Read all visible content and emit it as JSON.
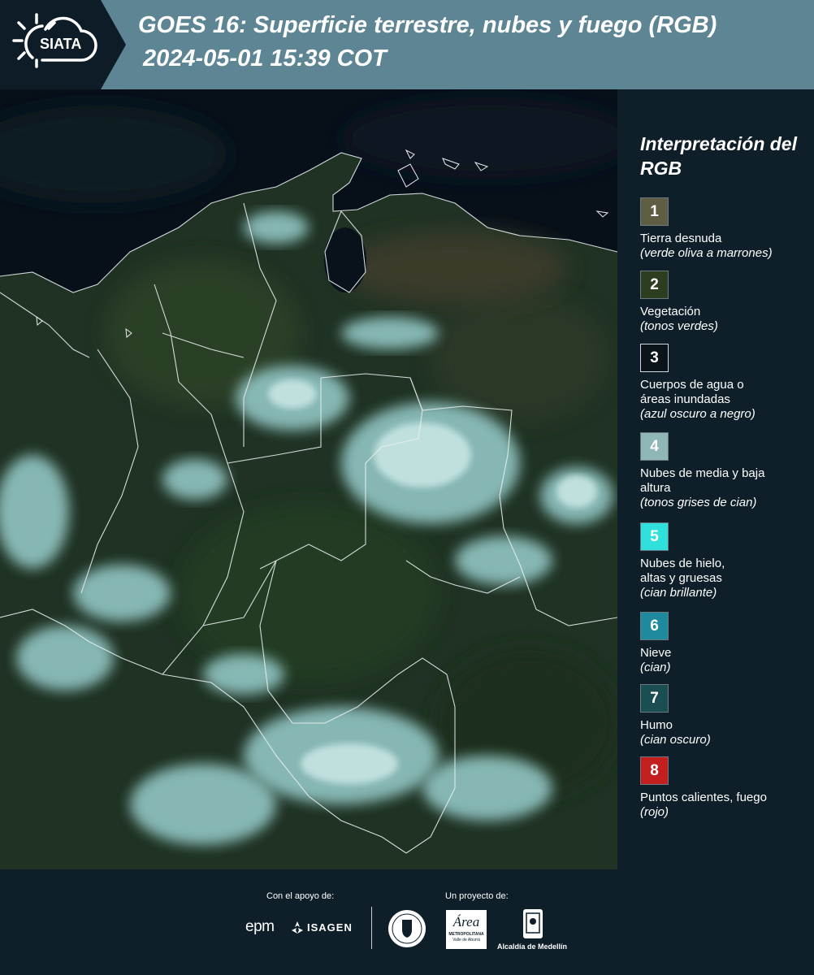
{
  "header": {
    "logo_text": "SIATA",
    "title_line1": "GOES 16: Superficie terrestre, nubes y fuego (RGB)",
    "title_line2": "2024-05-01 15:39 COT"
  },
  "legend": {
    "title": "Interpretación del RGB",
    "items": [
      {
        "number": "1",
        "label": "Tierra desnuda",
        "desc": "(verde oliva a marrones)",
        "color": "#5f5e45"
      },
      {
        "number": "2",
        "label": "Vegetación",
        "desc": "(tonos verdes)",
        "color": "#2c3d20"
      },
      {
        "number": "3",
        "label": "Cuerpos de agua o áreas inundadas",
        "desc": "(azul oscuro a negro)",
        "color": "#0b1418"
      },
      {
        "number": "4",
        "label": "Nubes de media y baja altura",
        "desc": "(tonos grises de cian)",
        "color": "#8fb7b5"
      },
      {
        "number": "5",
        "label": "Nubes de hielo, altas y gruesas",
        "desc": "(cian brillante)",
        "color": "#2fe0dc"
      },
      {
        "number": "6",
        "label": "Nieve",
        "desc": "(cian)",
        "color": "#1f8a9d"
      },
      {
        "number": "7",
        "label": "Humo",
        "desc": "(cian oscuro)",
        "color": "#1b4e52"
      },
      {
        "number": "8",
        "label": "Puntos calientes, fuego",
        "desc": "(rojo)",
        "color": "#c41f1f"
      }
    ]
  },
  "footer": {
    "support_label": "Con el apoyo de:",
    "project_label": "Un proyecto de:",
    "sponsor_epm": "epm",
    "sponsor_isagen": "ISAGEN",
    "partner_area": "Área",
    "partner_area_sub": "METROPOLITANA",
    "partner_area_sub2": "Valle de Aburrá",
    "partner_alcaldia": "Alcaldía de Medellín"
  }
}
